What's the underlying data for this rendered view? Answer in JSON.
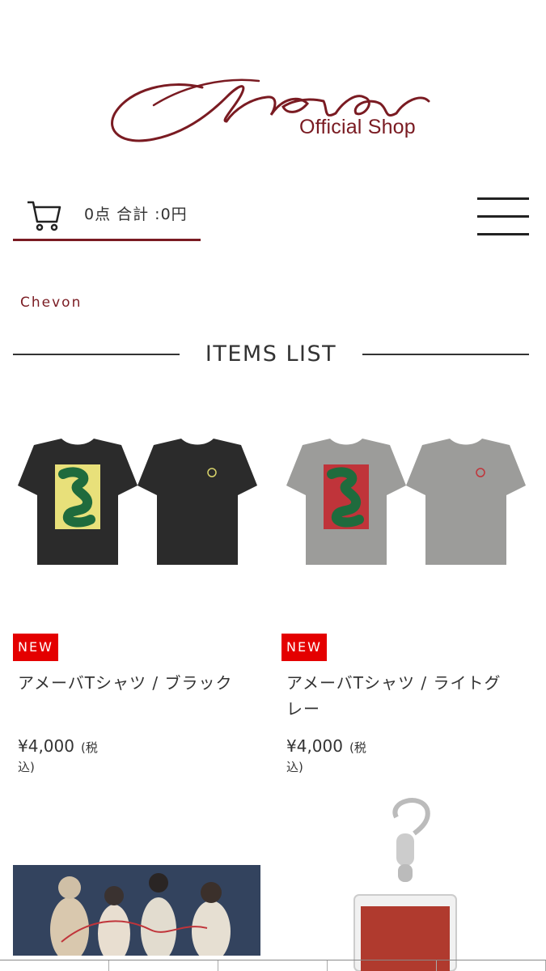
{
  "header": {
    "logo_script": "Chevon",
    "logo_sub": "Official Shop",
    "cart": "0点 合計 :0円",
    "menu_icon": "hamburger-icon",
    "cart_icon": "cart-icon"
  },
  "breadcrumb": "Chevon",
  "section_title": "ITEMS LIST",
  "products": [
    {
      "badge": "NEW",
      "name": "アメーバTシャツ / ブラック",
      "price": "¥4,000",
      "tax": "(税込)"
    },
    {
      "badge": "NEW",
      "name": "アメーバTシャツ / ライトグレー",
      "price": "¥4,000",
      "tax": "(税込)"
    }
  ],
  "colors": {
    "accent": "#7a1b22",
    "badge": "#e40000"
  }
}
